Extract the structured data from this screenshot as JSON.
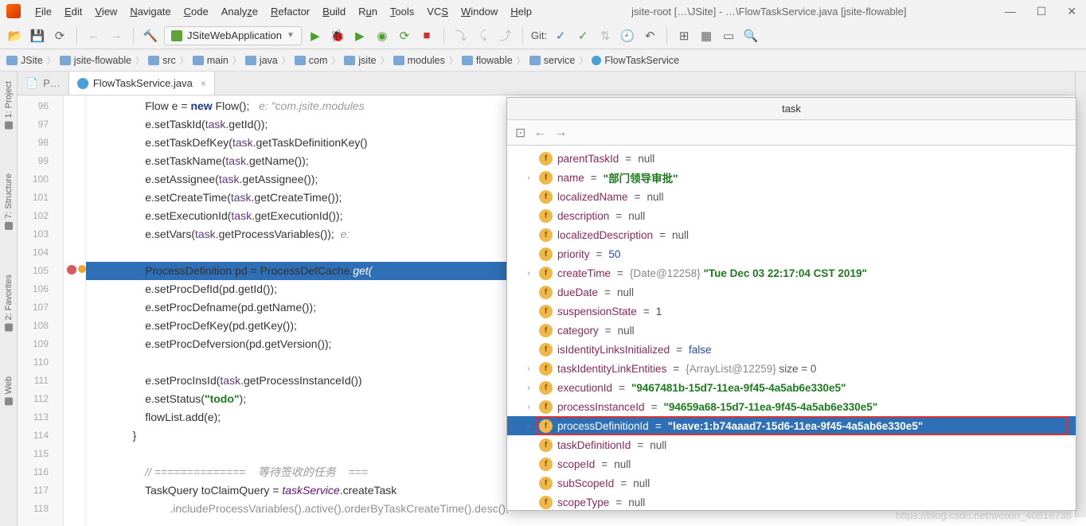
{
  "title": {
    "project": "jsite-root […\\JSite]",
    "path": "- …\\FlowTaskService.java [jsite-flowable]"
  },
  "menu": [
    "File",
    "Edit",
    "View",
    "Navigate",
    "Code",
    "Analyze",
    "Refactor",
    "Build",
    "Run",
    "Tools",
    "VCS",
    "Window",
    "Help"
  ],
  "runConfig": "JSiteWebApplication",
  "gitLabel": "Git:",
  "breadcrumb": [
    "JSite",
    "jsite-flowable",
    "src",
    "main",
    "java",
    "com",
    "jsite",
    "modules",
    "flowable",
    "service",
    "FlowTaskService"
  ],
  "leftTabs": [
    "1: Project",
    "7: Structure",
    "2: Favorites",
    "Web"
  ],
  "editorTabs": [
    {
      "label": "P…",
      "active": false
    },
    {
      "label": "FlowTaskService.java",
      "active": true
    }
  ],
  "code": {
    "start": 96,
    "lines": [
      {
        "n": 96,
        "html": "Flow e = <span class='kw'>new</span> Flow();   <span class='cm'>e: \"com.jsite.modules</span>"
      },
      {
        "n": 97,
        "html": "e.setTaskId(<span class='obj'>task</span>.getId());"
      },
      {
        "n": 98,
        "html": "e.setTaskDefKey(<span class='obj'>task</span>.getTaskDefinitionKey()"
      },
      {
        "n": 99,
        "html": "e.setTaskName(<span class='obj'>task</span>.getName());"
      },
      {
        "n": 100,
        "html": "e.setAssignee(<span class='obj'>task</span>.getAssignee());"
      },
      {
        "n": 101,
        "html": "e.setCreateTime(<span class='obj'>task</span>.getCreateTime());"
      },
      {
        "n": 102,
        "html": "e.setExecutionId(<span class='obj'>task</span>.getExecutionId());"
      },
      {
        "n": 103,
        "html": "e.setVars(<span class='obj'>task</span>.getProcessVariables());  <span class='cm'>e:</span>"
      },
      {
        "n": 104,
        "html": ""
      },
      {
        "n": 105,
        "html": "ProcessDefinition pd = ProcessDefCache.<span class='mtd'>get(</span>",
        "hl": true,
        "bp": true
      },
      {
        "n": 106,
        "html": "e.setProcDefId(pd.getId());"
      },
      {
        "n": 107,
        "html": "e.setProcDefname(pd.getName());"
      },
      {
        "n": 108,
        "html": "e.setProcDefKey(pd.getKey());"
      },
      {
        "n": 109,
        "html": "e.setProcDefversion(pd.getVersion());"
      },
      {
        "n": 110,
        "html": ""
      },
      {
        "n": 111,
        "html": "e.setProcInsId(<span class='obj'>task</span>.getProcessInstanceId())"
      },
      {
        "n": 112,
        "html": "e.setStatus(<span class='str'>\"todo\"</span>);"
      },
      {
        "n": 113,
        "html": "flowList.add(e);"
      },
      {
        "n": 114,
        "html": "}",
        "outdent": 1
      },
      {
        "n": 115,
        "html": ""
      },
      {
        "n": 116,
        "html": "<span class='cm'>// ==============    等待签收的任务    ===</span>"
      },
      {
        "n": 117,
        "html": "TaskQuery toClaimQuery = <span class='fld'>taskService</span>.createTask"
      },
      {
        "n": 118,
        "html": "        .includeProcessVariables().active().orderByTaskCreateTime().desc();",
        "dim": true
      }
    ]
  },
  "debug": {
    "title": "task",
    "rows": [
      {
        "k": "parentTaskId",
        "v": "null",
        "t": "null"
      },
      {
        "k": "name",
        "v": "\"部门领导审批\"",
        "t": "str",
        "exp": true
      },
      {
        "k": "localizedName",
        "v": "null",
        "t": "null"
      },
      {
        "k": "description",
        "v": "null",
        "t": "null"
      },
      {
        "k": "localizedDescription",
        "v": "null",
        "t": "null"
      },
      {
        "k": "priority",
        "v": "50",
        "t": "num"
      },
      {
        "k": "createTime",
        "v": "{Date@12258} \"Tue Dec 03 22:17:04 CST 2019\"",
        "t": "obj",
        "exp": true
      },
      {
        "k": "dueDate",
        "v": "null",
        "t": "null"
      },
      {
        "k": "suspensionState",
        "v": "1",
        "t": "num"
      },
      {
        "k": "category",
        "v": "null",
        "t": "null"
      },
      {
        "k": "isIdentityLinksInitialized",
        "v": "false",
        "t": "num"
      },
      {
        "k": "taskIdentityLinkEntities",
        "v": "{ArrayList@12259}  size = 0",
        "t": "obj",
        "exp": true
      },
      {
        "k": "executionId",
        "v": "\"9467481b-15d7-11ea-9f45-4a5ab6e330e5\"",
        "t": "str",
        "exp": true
      },
      {
        "k": "processInstanceId",
        "v": "\"94659a68-15d7-11ea-9f45-4a5ab6e330e5\"",
        "t": "str",
        "exp": true
      },
      {
        "k": "processDefinitionId",
        "v": "\"leave:1:b74aaad7-15d6-11ea-9f45-4a5ab6e330e5\"",
        "t": "str",
        "exp": true,
        "sel": true,
        "box": true
      },
      {
        "k": "taskDefinitionId",
        "v": "null",
        "t": "null"
      },
      {
        "k": "scopeId",
        "v": "null",
        "t": "null"
      },
      {
        "k": "subScopeId",
        "v": "null",
        "t": "null"
      },
      {
        "k": "scopeType",
        "v": "null",
        "t": "null"
      }
    ]
  },
  "watermark": "https://blog.csdn.net/weixin_40816738"
}
